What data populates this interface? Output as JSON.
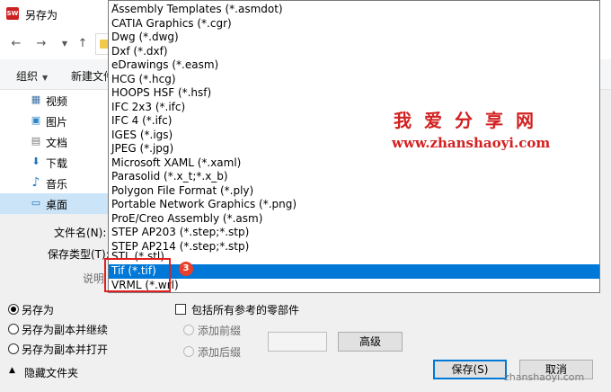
{
  "window": {
    "title": "另存为",
    "app_icon_text": "SW"
  },
  "nav": {
    "back_icon": "arrow-left-icon",
    "forward_icon": "arrow-right-icon",
    "down_icon": "chevron-down-icon",
    "up_icon": "arrow-up-icon"
  },
  "toolbar": {
    "organize_label": "组织",
    "new_folder_label": "新建文件"
  },
  "sidebar": {
    "items": [
      {
        "label": "视频",
        "icon": "video-icon",
        "glyph": "▦"
      },
      {
        "label": "图片",
        "icon": "picture-icon",
        "glyph": "▣"
      },
      {
        "label": "文档",
        "icon": "document-icon",
        "glyph": "▤"
      },
      {
        "label": "下载",
        "icon": "download-icon",
        "glyph": "⬇"
      },
      {
        "label": "音乐",
        "icon": "music-icon",
        "glyph": "♪"
      },
      {
        "label": "桌面",
        "icon": "desktop-icon",
        "glyph": "▭",
        "selected": true
      }
    ]
  },
  "form": {
    "filename_label": "文件名(N):",
    "filetype_label": "保存类型(T):",
    "description_label": "说明"
  },
  "file_types": {
    "items": [
      "Assembly Templates (*.asmdot)",
      "CATIA Graphics (*.cgr)",
      "Dwg (*.dwg)",
      "Dxf (*.dxf)",
      "eDrawings (*.easm)",
      "HCG (*.hcg)",
      "HOOPS HSF (*.hsf)",
      "IFC 2x3 (*.ifc)",
      "IFC 4 (*.ifc)",
      "IGES (*.igs)",
      "JPEG (*.jpg)",
      "Microsoft XAML (*.xaml)",
      "Parasolid (*.x_t;*.x_b)",
      "Polygon File Format (*.ply)",
      "Portable Network Graphics (*.png)",
      "ProE/Creo Assembly (*.asm)",
      "STEP AP203 (*.step;*.stp)",
      "STEP AP214 (*.step;*.stp)",
      "STL (*.stl)",
      "Tif (*.tif)",
      "VRML (*.wrl)"
    ],
    "selected_index": 19
  },
  "options": {
    "save_as": "另存为",
    "save_copy_continue": "另存为副本并继续",
    "save_copy_open": "另存为副本并打开",
    "include_refs": "包括所有参考的零部件",
    "add_prefix": "添加前缀",
    "add_suffix": "添加后缀",
    "advanced_button": "高级",
    "hide_folders": "隐藏文件夹",
    "save_button": "保存(S)",
    "cancel_button": "取消"
  },
  "annotation": {
    "step_number": "3"
  },
  "watermark": {
    "title": "我爱分享网",
    "url": "www.zhanshaoyi.com",
    "corner": "zhanshaoyi.com"
  },
  "colors": {
    "selection": "#0078d7",
    "annotation_red": "#e02020",
    "watermark_red": "#d32020"
  }
}
